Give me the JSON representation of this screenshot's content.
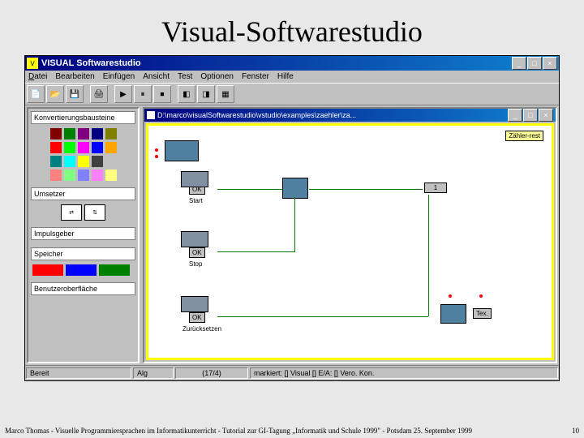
{
  "slide": {
    "title": "Visual-Softwarestudio"
  },
  "window": {
    "app_icon": "V",
    "title": "VISUAL Softwarestudio",
    "min": "_",
    "max": "□",
    "close": "×"
  },
  "menu": {
    "datei": "Datei",
    "bearbeiten": "Bearbeiten",
    "einfuegen": "Einfügen",
    "ansicht": "Ansicht",
    "test": "Test",
    "optionen": "Optionen",
    "fenster": "Fenster",
    "hilfe": "Hilfe"
  },
  "palette": {
    "konv": "Konvertierungsbausteine",
    "umsetzer": "Umsetzer",
    "impuls": "Impulsgeber",
    "speicher": "Speicher",
    "oberflaeche": "Benutzeroberfläche",
    "swatches": [
      "#800000",
      "#008000",
      "#800080",
      "#000080",
      "#808000",
      "#ff0000",
      "#00ff00",
      "#ff00ff",
      "#0000ff",
      "#ffa500",
      "#008080",
      "#00ffff",
      "#ffff00",
      "#404040",
      "#c0c0c0",
      "#ff8080",
      "#80ff80",
      "#8080ff",
      "#ff80ff",
      "#ffff80"
    ],
    "bars": [
      "#ff0000",
      "#0000ff",
      "#008000"
    ]
  },
  "document": {
    "path": "D:\\marco\\visualSoftwarestudio\\vstudio\\examples\\zaehler\\za...",
    "nodes": {
      "zaehler": "Zähler-rest",
      "start_ok": "OK",
      "start": "Start",
      "stop_ok": "OK",
      "stop": "Stop",
      "reset_ok": "OK",
      "reset": "Zurücksetzen",
      "one": "1",
      "text": "Tex."
    }
  },
  "status": {
    "bereit": "Bereit",
    "pos": "(17/4)",
    "markiert": "markiert: [] Visual   [] E/A: [] Vero.    Kon."
  },
  "toolbar_field": "Alg",
  "footer": {
    "text": "Marco Thomas - Visuelle Programmiersprachen im Informatikunterricht - Tutorial zur GI-Tagung „Informatik und Schule 1999\" - Potsdam 25. September 1999",
    "page": "10"
  }
}
